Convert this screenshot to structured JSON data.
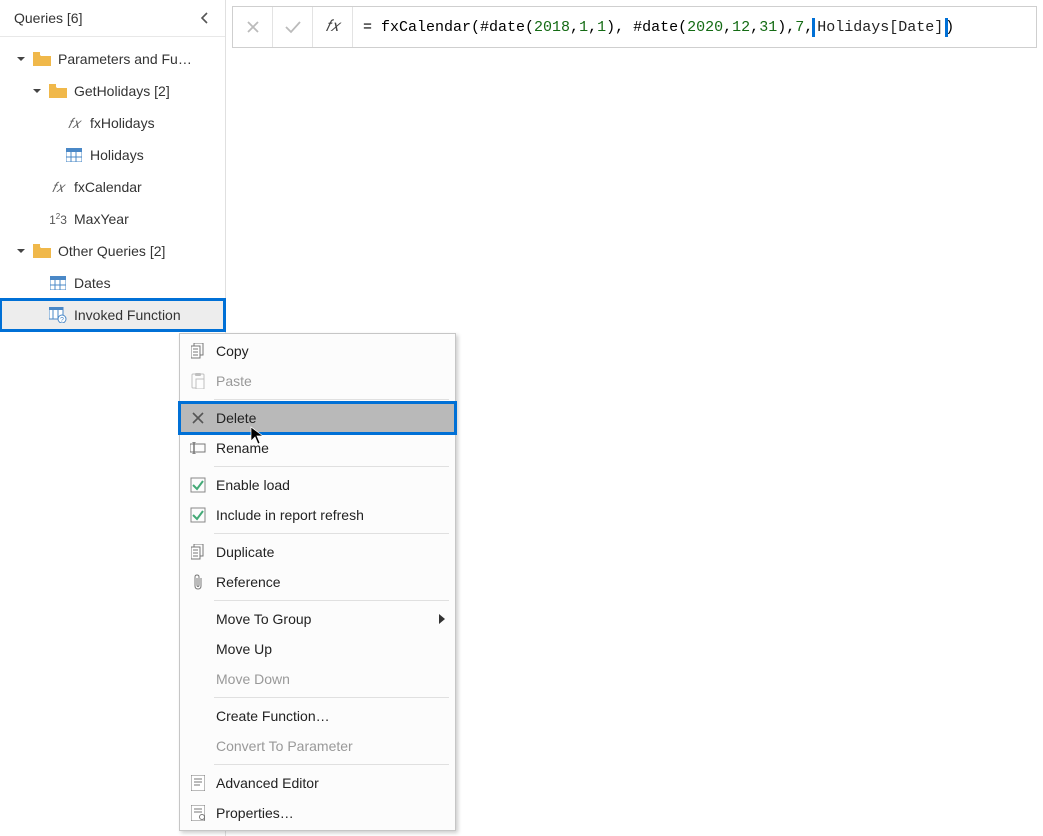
{
  "sidebar": {
    "title": "Queries [6]",
    "groups": [
      {
        "label": "Parameters and Fu…",
        "expanded": true,
        "indent": 0,
        "icon": "folder"
      },
      {
        "label": "GetHolidays [2]",
        "expanded": true,
        "indent": 1,
        "icon": "folder"
      },
      {
        "label": "fxHolidays",
        "indent": 2,
        "icon": "fx"
      },
      {
        "label": "Holidays",
        "indent": 2,
        "icon": "table"
      },
      {
        "label": "fxCalendar",
        "indent": 1,
        "icon": "fx"
      },
      {
        "label": "MaxYear",
        "indent": 1,
        "icon": "num"
      },
      {
        "label": "Other Queries [2]",
        "expanded": true,
        "indent": 0,
        "icon": "folder"
      },
      {
        "label": "Dates",
        "indent": 1,
        "icon": "table"
      },
      {
        "label": "Invoked Function",
        "indent": 1,
        "icon": "table-q",
        "selected": true
      }
    ]
  },
  "formula": {
    "p1": "= fxCalendar(#date(",
    "y1": "2018",
    "c1": ", ",
    "m1": "1",
    "c2": ", ",
    "d1": "1",
    "p2": "), #date(",
    "y2": "2020",
    "c3": ", ",
    "m2": "12",
    "c4": ", ",
    "d2": "31",
    "p3": "), ",
    "n1": "7",
    "c5": ", ",
    "hl": "Holidays[Date]",
    "p4": ")"
  },
  "contextMenu": {
    "items": [
      {
        "label": "Copy",
        "icon": "copy"
      },
      {
        "label": "Paste",
        "icon": "paste",
        "disabled": true
      },
      {
        "sep": true
      },
      {
        "label": "Delete",
        "icon": "delete",
        "highlighted": true
      },
      {
        "label": "Rename",
        "icon": "rename"
      },
      {
        "sep": true
      },
      {
        "label": "Enable load",
        "icon": "checked"
      },
      {
        "label": "Include in report refresh",
        "icon": "checked"
      },
      {
        "sep": true
      },
      {
        "label": "Duplicate",
        "icon": "copy"
      },
      {
        "label": "Reference",
        "icon": "clip"
      },
      {
        "sep": true
      },
      {
        "label": "Move To Group",
        "sub": true
      },
      {
        "label": "Move Up"
      },
      {
        "label": "Move Down",
        "disabled": true
      },
      {
        "sep": true
      },
      {
        "label": "Create Function…"
      },
      {
        "label": "Convert To Parameter",
        "disabled": true
      },
      {
        "sep": true
      },
      {
        "label": "Advanced Editor",
        "icon": "editor"
      },
      {
        "label": "Properties…",
        "icon": "props"
      }
    ]
  }
}
